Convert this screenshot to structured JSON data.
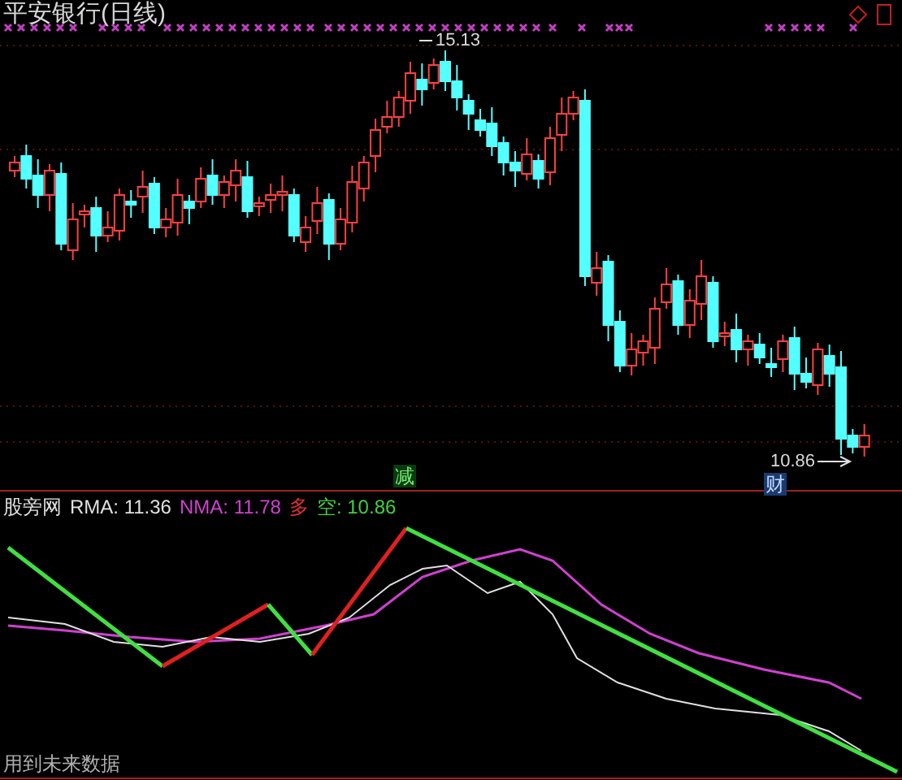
{
  "main_chart": {
    "title": "平安银行(日线)",
    "high_label": "15.13",
    "low_label": "10.86"
  },
  "signals": [
    {
      "kind": "reduce",
      "label": "减"
    },
    {
      "kind": "finance",
      "label": "财"
    }
  ],
  "indicator": {
    "name": "股旁网",
    "legend": [
      {
        "label": "RMA: 11.36",
        "color": "#e0e0e0"
      },
      {
        "label": "NMA: 11.78",
        "color": "#d040d0"
      },
      {
        "label": "多",
        "color": "#e03030"
      },
      {
        "label": "空: 10.86",
        "color": "#40d040"
      }
    ]
  },
  "footer": "用到未来数据"
}
